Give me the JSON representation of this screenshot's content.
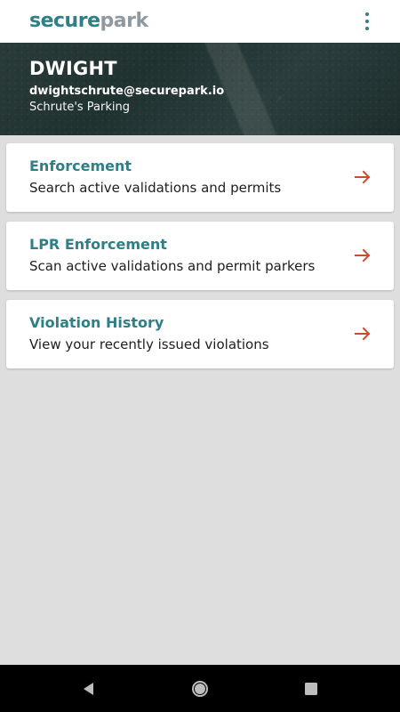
{
  "app": {
    "logo_part1": "secure",
    "logo_part2": "park"
  },
  "user": {
    "name": "DWIGHT",
    "email": "dwightschrute@securepark.io",
    "lot": "Schrute's Parking"
  },
  "cards": [
    {
      "title": "Enforcement",
      "subtitle": "Search active validations and permits"
    },
    {
      "title": "LPR Enforcement",
      "subtitle": "Scan active validations and permit parkers"
    },
    {
      "title": "Violation History",
      "subtitle": "View your recently issued violations"
    }
  ],
  "icons": {
    "menu": "more-vertical-icon",
    "arrow": "arrow-right-icon",
    "back": "back-icon",
    "home": "home-icon",
    "recents": "recent-apps-icon"
  },
  "colors": {
    "brand": "#2f7f86",
    "brand_secondary": "#8f9aa0",
    "accent": "#cf4b2f",
    "background": "#dedede"
  }
}
